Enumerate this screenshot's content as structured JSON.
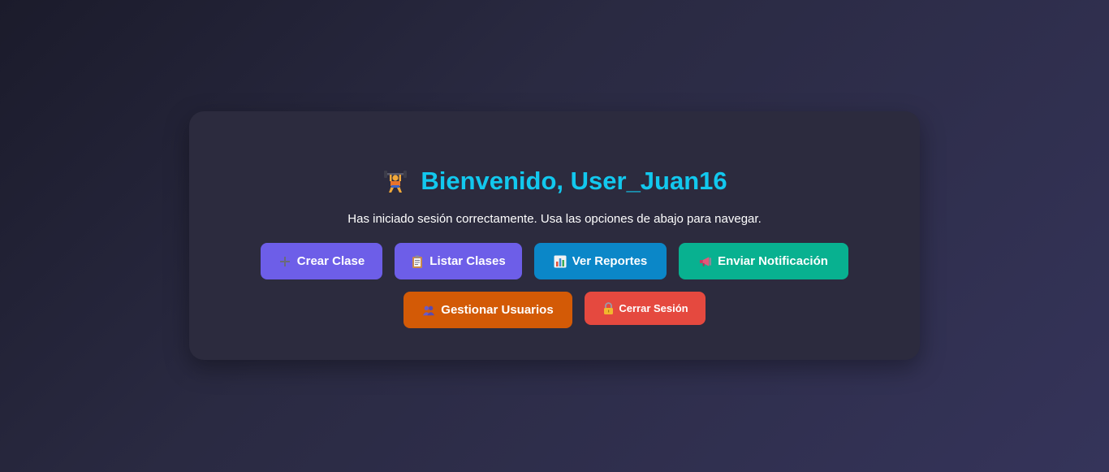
{
  "welcome": {
    "title": "Bienvenido, User_Juan16",
    "title_icon": "weightlifter-icon",
    "subtitle": "Has iniciado sesión correctamente. Usa las opciones de abajo para navegar."
  },
  "actions": {
    "crear_clase": {
      "label": "Crear Clase",
      "icon": "plus-icon"
    },
    "listar_clases": {
      "label": "Listar Clases",
      "icon": "clipboard-icon"
    },
    "ver_reportes": {
      "label": "Ver Reportes",
      "icon": "bar-chart-icon"
    },
    "enviar_notificacion": {
      "label": "Enviar Notificación",
      "icon": "megaphone-icon"
    },
    "gestionar_usuarios": {
      "label": "Gestionar Usuarios",
      "icon": "users-icon"
    },
    "cerrar_sesion": {
      "label": "Cerrar Sesión",
      "icon": "lock-icon"
    }
  },
  "colors": {
    "title": "#12c8ee",
    "card": "#2c2b3e",
    "purple": "#6d5ee8",
    "blue": "#0b87c8",
    "green": "#08b190",
    "orange": "#d35a06",
    "red": "#e5493f"
  }
}
